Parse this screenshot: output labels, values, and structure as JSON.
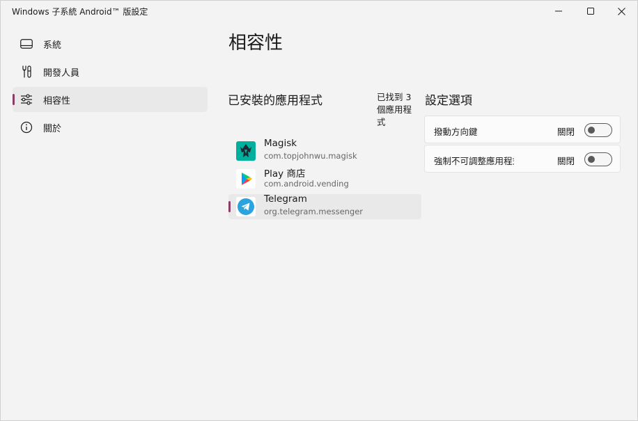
{
  "window": {
    "title": "Windows 子系統 Android™ 版設定",
    "controls": [
      "minimize",
      "maximize",
      "close"
    ]
  },
  "sidebar": {
    "items": [
      {
        "label": "系統",
        "icon": "display-icon",
        "selected": false
      },
      {
        "label": "開發人員",
        "icon": "tools-icon",
        "selected": false
      },
      {
        "label": "相容性",
        "icon": "sliders-icon",
        "selected": true
      },
      {
        "label": "關於",
        "icon": "info-icon",
        "selected": false
      }
    ]
  },
  "main": {
    "title": "相容性",
    "apps_section": {
      "heading": "已安裝的應用程式",
      "found_count": "已找到 3 個應用程式",
      "apps": [
        {
          "name": "Magisk",
          "package": "com.topjohnwu.magisk",
          "icon": "magisk-icon",
          "selected": false
        },
        {
          "name": "Play 商店",
          "package": "com.android.vending",
          "icon": "play-store-icon",
          "selected": false
        },
        {
          "name": "Telegram",
          "package": "org.telegram.messenger",
          "icon": "telegram-icon",
          "selected": true
        }
      ]
    },
    "settings_section": {
      "heading": "設定選項",
      "options": [
        {
          "label": "撥動方向鍵",
          "state": "關閉",
          "on": false
        },
        {
          "label": "強制不可調整應用程式大小",
          "state": "關閉",
          "on": false
        }
      ]
    }
  },
  "colors": {
    "accent": "#8a3e63",
    "background": "#f3f3f3",
    "selected_background": "#e9e9e9",
    "card_background": "#fbfbfb"
  }
}
